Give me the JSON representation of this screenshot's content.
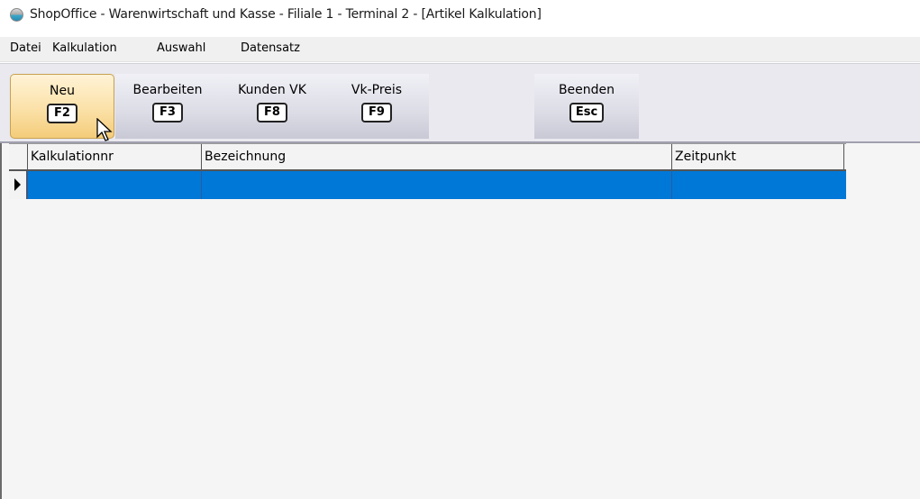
{
  "window": {
    "title": "ShopOffice - Warenwirtschaft und Kasse - Filiale 1 - Terminal 2 - [Artikel Kalkulation]"
  },
  "menu": [
    "Datei",
    "Kalkulation",
    "Auswahl",
    "Datensatz"
  ],
  "toolbar": {
    "buttons": [
      {
        "label": "Neu",
        "key": "F2"
      },
      {
        "label": "Bearbeiten",
        "key": "F3"
      },
      {
        "label": "Kunden VK",
        "key": "F8"
      },
      {
        "label": "Vk-Preis",
        "key": "F9"
      },
      {
        "label": "Beenden",
        "key": "Esc"
      }
    ]
  },
  "grid": {
    "columns": [
      "Kalkulationnr",
      "Bezeichnung",
      "Zeitpunkt"
    ],
    "rows": [
      {
        "Kalkulationnr": "",
        "Bezeichnung": "",
        "Zeitpunkt": ""
      }
    ]
  },
  "colors": {
    "selection": "#0078d7",
    "active_button": "#fbe1a8"
  }
}
